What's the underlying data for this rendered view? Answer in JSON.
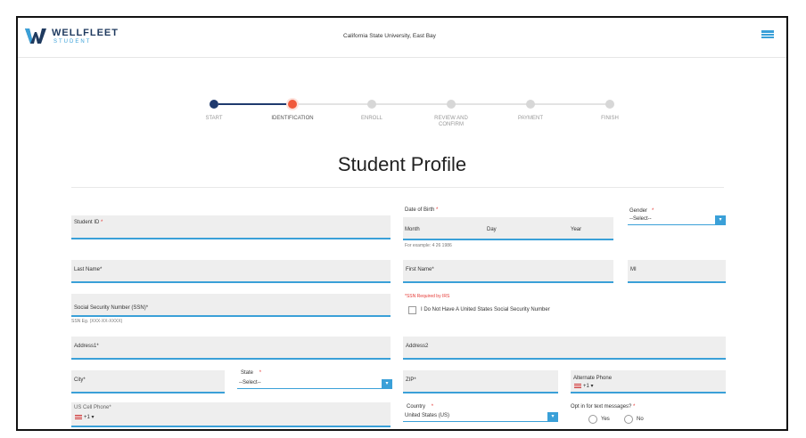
{
  "header": {
    "brand": "WELLFLEET",
    "brand_sub": "STUDENT",
    "university": "California State University, East Bay"
  },
  "steps": [
    {
      "label": "START",
      "state": "done"
    },
    {
      "label": "IDENTIFICATION",
      "state": "current"
    },
    {
      "label": "ENROLL",
      "state": "todo"
    },
    {
      "label": "REVIEW AND CONFIRM",
      "state": "todo"
    },
    {
      "label": "PAYMENT",
      "state": "todo"
    },
    {
      "label": "FINISH",
      "state": "todo"
    }
  ],
  "page_title": "Student Profile",
  "form": {
    "student_id": {
      "label": "Student ID",
      "required": "*"
    },
    "dob": {
      "label": "Date of Birth",
      "required": "*",
      "month": "Month",
      "day": "Day",
      "year": "Year",
      "hint": "For example: 4 26 1986"
    },
    "gender": {
      "label": "Gender",
      "required": "*",
      "value": "--Select--"
    },
    "last_name": {
      "label": "Last Name*"
    },
    "first_name": {
      "label": "First Name*"
    },
    "mi": {
      "label": "MI"
    },
    "ssn": {
      "label": "Social Security Number (SSN)*",
      "hint": "SSN Eg. (XXX-XX-XXXX)"
    },
    "ssn_irs_note": "*SSN Required by IRS",
    "no_ssn_label": "I Do Not Have A United States Social Security Number",
    "address": {
      "label": "Address1*"
    },
    "address2": {
      "label": "Address2"
    },
    "city": {
      "label": "City*"
    },
    "state": {
      "label": "State",
      "required": "*",
      "value": "--Select--"
    },
    "zip": {
      "label": "ZIP*"
    },
    "alt_phone": {
      "label": "Alternate Phone",
      "code": "+1"
    },
    "cell_phone": {
      "label": "US Cell Phone*",
      "code": "+1"
    },
    "country": {
      "label": "Country",
      "required": "*",
      "value": "United States (US)"
    },
    "opt_in": {
      "label": "Opt in for text messages?",
      "required": "*",
      "yes": "Yes",
      "no": "No"
    }
  },
  "colors": {
    "accent": "#3aa0d8",
    "step_done": "#1f3a6e",
    "step_current": "#f05a3c",
    "required": "#e53935"
  }
}
